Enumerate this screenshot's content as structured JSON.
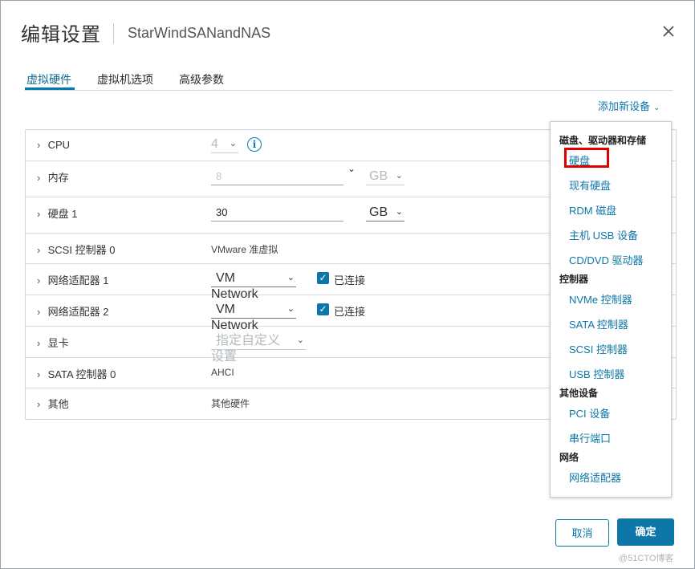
{
  "dialog": {
    "title": "编辑设置",
    "subtitle": "StarWindSANandNAS"
  },
  "tabs": [
    {
      "label": "虚拟硬件",
      "active": true
    },
    {
      "label": "虚拟机选项",
      "active": false
    },
    {
      "label": "高级参数",
      "active": false
    }
  ],
  "add_device": {
    "label": "添加新设备"
  },
  "hardware": {
    "cpu": {
      "label": "CPU",
      "value": "4"
    },
    "memory": {
      "label": "内存",
      "value": "8",
      "unit": "GB"
    },
    "disk1": {
      "label": "硬盘 1",
      "value": "30",
      "unit": "GB"
    },
    "scsi0": {
      "label": "SCSI 控制器 0",
      "value": "VMware 准虚拟"
    },
    "nic1": {
      "label": "网络适配器 1",
      "value": "VM Network",
      "connected_label": "已连接"
    },
    "nic2": {
      "label": "网络适配器 2",
      "value": "VM Network",
      "connected_label": "已连接"
    },
    "video": {
      "label": "显卡",
      "value": "指定自定义设置"
    },
    "sata0": {
      "label": "SATA 控制器 0",
      "value": "AHCI"
    },
    "other": {
      "label": "其他",
      "value": "其他硬件"
    }
  },
  "menu": {
    "groups": [
      {
        "header": "磁盘、驱动器和存储",
        "items": [
          "硬盘",
          "现有硬盘",
          "RDM 磁盘",
          "主机 USB 设备",
          "CD/DVD 驱动器"
        ]
      },
      {
        "header": "控制器",
        "items": [
          "NVMe 控制器",
          "SATA 控制器",
          "SCSI 控制器",
          "USB 控制器"
        ]
      },
      {
        "header": "其他设备",
        "items": [
          "PCI 设备",
          "串行端口"
        ]
      },
      {
        "header": "网络",
        "items": [
          "网络适配器"
        ]
      }
    ]
  },
  "footer": {
    "cancel_label": "取消",
    "ok_label": "确定"
  },
  "watermark": "@51CTO博客",
  "colors": {
    "accent": "#0d77a8",
    "highlight": "#e10000"
  }
}
